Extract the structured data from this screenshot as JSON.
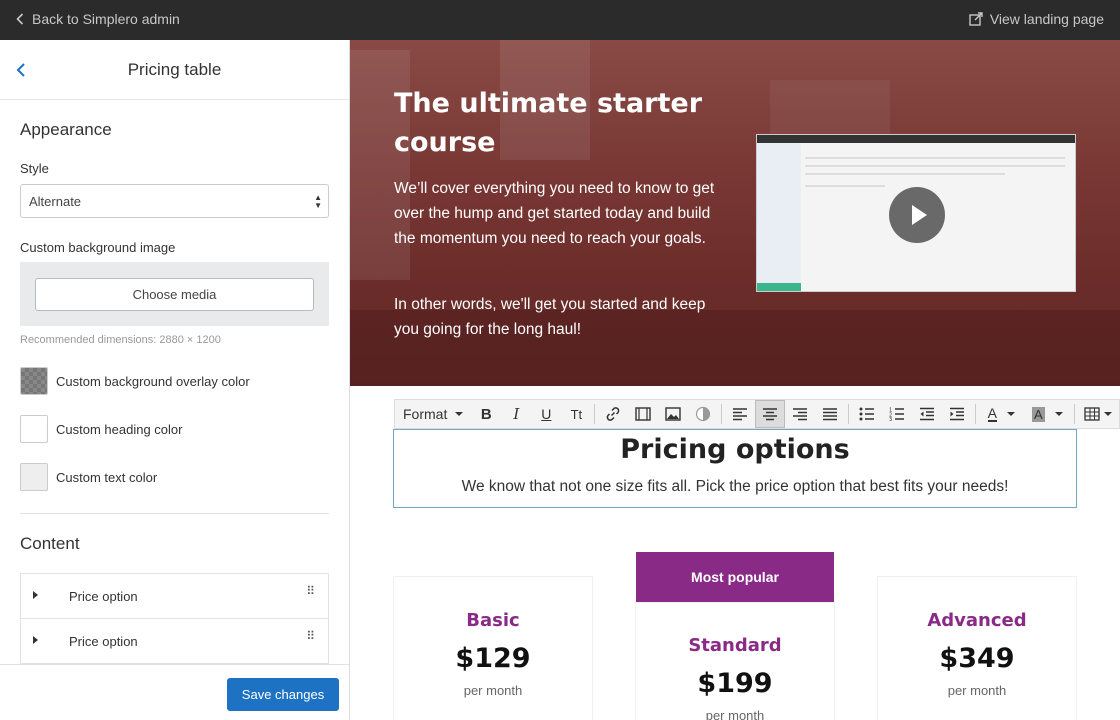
{
  "topbar": {
    "back_label": "Back to Simplero admin",
    "view_label": "View landing page"
  },
  "sidebar": {
    "title": "Pricing table",
    "appearance": {
      "heading": "Appearance",
      "style_label": "Style",
      "style_value": "Alternate",
      "bg_image_label": "Custom background image",
      "choose_media": "Choose media",
      "recommended": "Recommended dimensions: 2880 × 1200",
      "overlay_color_label": "Custom background overlay color",
      "heading_color_label": "Custom heading color",
      "text_color_label": "Custom text color"
    },
    "content": {
      "heading": "Content",
      "items": [
        {
          "label": "Price option"
        },
        {
          "label": "Price option"
        }
      ]
    },
    "save_label": "Save changes"
  },
  "hero": {
    "title": "The ultimate starter course",
    "paragraph1": "We’ll cover everything you need to know to get over the hump and get started today and build the momentum you need to reach your goals.",
    "paragraph2": "In other words, we'll get you started and keep you going for the long haul!"
  },
  "toolbar": {
    "format_label": "Format",
    "buttons": [
      "bold-icon",
      "italic-icon",
      "underline-icon",
      "text-size-icon",
      "link-icon",
      "video-icon",
      "image-icon",
      "contrast-icon",
      "align-left-icon",
      "align-center-icon",
      "align-right-icon",
      "align-justify-icon",
      "bullet-list-icon",
      "numbered-list-icon",
      "outdent-icon",
      "indent-icon",
      "font-color-icon",
      "highlight-color-icon",
      "table-icon"
    ]
  },
  "pricing": {
    "heading": "Pricing options",
    "subheading": "We know that not one size fits all. Pick the price option that best fits your needs!",
    "badge": "Most popular",
    "plans": [
      {
        "name": "Basic",
        "price": "$129",
        "period": "per month"
      },
      {
        "name": "Standard",
        "price": "$199",
        "period": "per month"
      },
      {
        "name": "Advanced",
        "price": "$349",
        "period": "per month"
      }
    ]
  },
  "colors": {
    "topbar": "#2b2b2b",
    "primary_button": "#1d72c4",
    "brand_purple": "#8a2a87",
    "hero_tint": "#8e4a45"
  }
}
